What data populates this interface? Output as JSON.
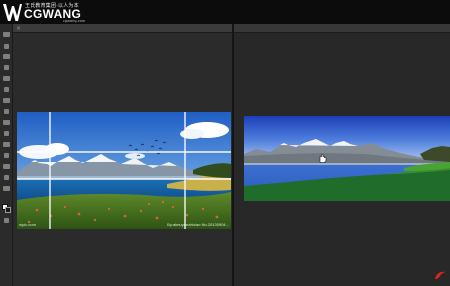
{
  "brand": {
    "name": "CGWANG",
    "tagline": "王氏教育集团·以人为本",
    "url": "cgwang.com"
  },
  "colors": {
    "accent": "#d8261c",
    "canvas_bg": "#2b2b2b",
    "ui_dark": "#0c0c0c"
  },
  "left_document": {
    "watermark_left": "nipic.com",
    "watermark_right": "By:aimuyuezhixiao  No.20130904..."
  },
  "icons": {
    "cursor": "hand-cursor-icon",
    "corner": "brand-corner-icon"
  }
}
